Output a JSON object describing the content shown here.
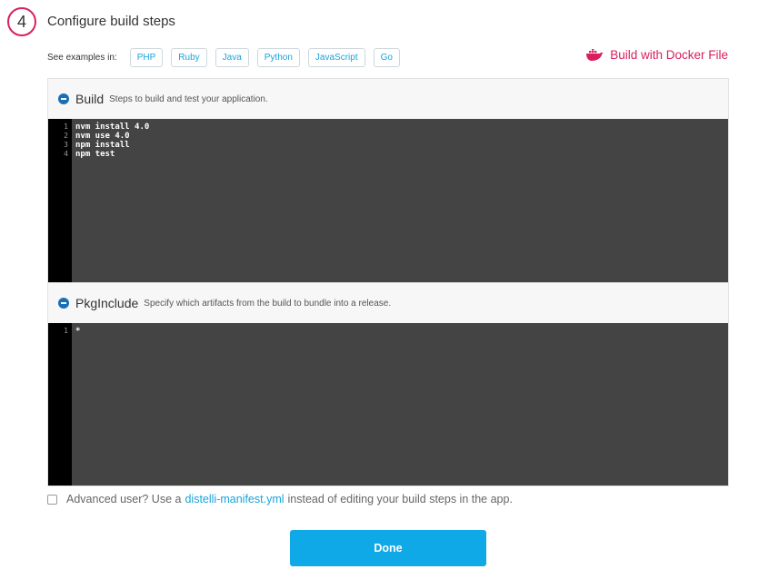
{
  "step": {
    "number": "4",
    "title": "Configure build steps"
  },
  "examples": {
    "label": "See examples in:",
    "languages": [
      "PHP",
      "Ruby",
      "Java",
      "Python",
      "JavaScript",
      "Go"
    ]
  },
  "docker": {
    "label": "Build with Docker File",
    "icon": "docker-whale-icon",
    "color": "#d9205d"
  },
  "build": {
    "title": "Build",
    "description": "Steps to build and test your application.",
    "line_numbers": [
      "1",
      "2",
      "3",
      "4"
    ],
    "lines": [
      "nvm install 4.0",
      "nvm use 4.0",
      "npm install",
      "npm test"
    ]
  },
  "pkginclude": {
    "title": "PkgInclude",
    "description": "Specify which artifacts from the build to bundle into a release.",
    "line_numbers": [
      "1"
    ],
    "lines": [
      "*"
    ]
  },
  "advanced": {
    "prefix": "Advanced user? Use a",
    "link": "distelli-manifest.yml",
    "suffix": "instead of editing your build steps in the app.",
    "checked": false
  },
  "done_label": "Done",
  "colors": {
    "accent": "#d9205d",
    "link": "#1aa3dc",
    "primary_button": "#0fa9e8",
    "editor_bg": "#444444",
    "gutter_bg": "#000000"
  }
}
